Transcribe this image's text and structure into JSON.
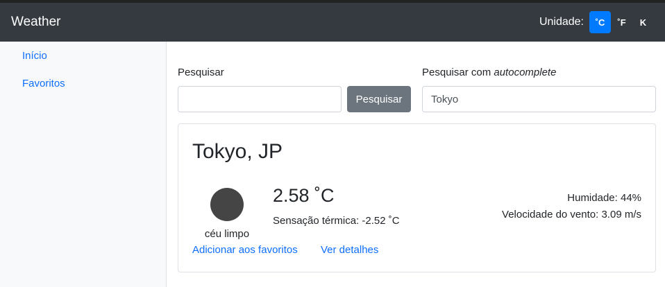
{
  "navbar": {
    "brand": "Weather",
    "unit_label": "Unidade:",
    "units": [
      {
        "label": "˚C",
        "active": true
      },
      {
        "label": "˚F",
        "active": false
      },
      {
        "label": "K",
        "active": false
      }
    ]
  },
  "sidebar": {
    "items": [
      {
        "label": "Início"
      },
      {
        "label": "Favoritos"
      }
    ]
  },
  "search": {
    "label": "Pesquisar",
    "value": "",
    "button_label": "Pesquisar",
    "autocomplete_label_prefix": "Pesquisar com ",
    "autocomplete_label_em": "autocomplete",
    "autocomplete_value": "Tokyo"
  },
  "weather": {
    "city": "Tokyo, JP",
    "description": "céu limpo",
    "temperature": "2.58 ˚C",
    "feels_like": "Sensação térmica: -2.52 ˚C",
    "humidity": "Humidade: 44%",
    "wind": "Velocidade do vento: 3.09 m/s",
    "add_favorites": "Adicionar aos favoritos",
    "details": "Ver detalhes",
    "icon": "clear-sky-icon"
  },
  "colors": {
    "navbar": "#343a40",
    "accent": "#007bff",
    "link": "#0d6efd",
    "secondary_button": "#6c757d"
  }
}
